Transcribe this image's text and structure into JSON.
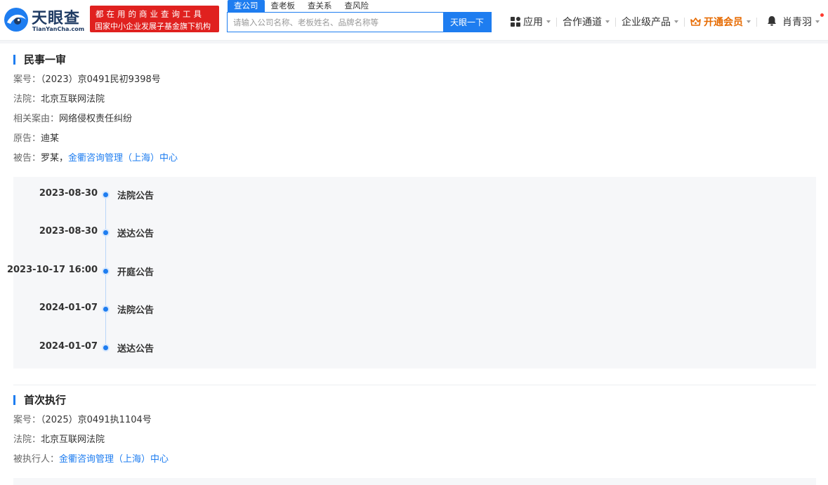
{
  "header": {
    "logo_cn": "天眼查",
    "logo_en": "TianYanCha.com",
    "slogan_line1": "都在用的商业查询工具",
    "slogan_line2": "国家中小企业发展子基金旗下机构",
    "search_tabs": [
      "查公司",
      "查老板",
      "查关系",
      "查风险"
    ],
    "search_placeholder": "请输入公司名称、老板姓名、品牌名称等",
    "search_button": "天眼一下",
    "nav": {
      "apps": "应用",
      "partners": "合作通道",
      "enterprise": "企业级产品",
      "vip": "开通会员",
      "user": "肖青羽"
    },
    "colors": {
      "accent": "#1e7df0",
      "slogan_bg": "#e0211f",
      "vip": "#e66a00"
    }
  },
  "case1": {
    "title": "民事一审",
    "case_no_label": "案号：",
    "case_no": "（2023）京0491民初9398号",
    "court_label": "法院：",
    "court": "北京互联网法院",
    "cause_label": "相关案由：",
    "cause": "网络侵权责任纠纷",
    "plaintiff_label": "原告：",
    "plaintiff": "迪某",
    "defendant_label": "被告：",
    "defendant_person": "罗某，",
    "defendant_company": "金衢咨询管理（上海）中心",
    "timeline": [
      {
        "date": "2023-08-30",
        "type": "法院公告"
      },
      {
        "date": "2023-08-30",
        "type": "送达公告"
      },
      {
        "date": "2023-10-17 16:00",
        "type": "开庭公告"
      },
      {
        "date": "2024-01-07",
        "type": "法院公告"
      },
      {
        "date": "2024-01-07",
        "type": "送达公告"
      }
    ]
  },
  "case2": {
    "title": "首次执行",
    "case_no_label": "案号：",
    "case_no": "（2025）京0491执1104号",
    "court_label": "法院：",
    "court": "北京互联网法院",
    "executed_label": "被执行人：",
    "executed": "金衢咨询管理（上海）中心"
  }
}
